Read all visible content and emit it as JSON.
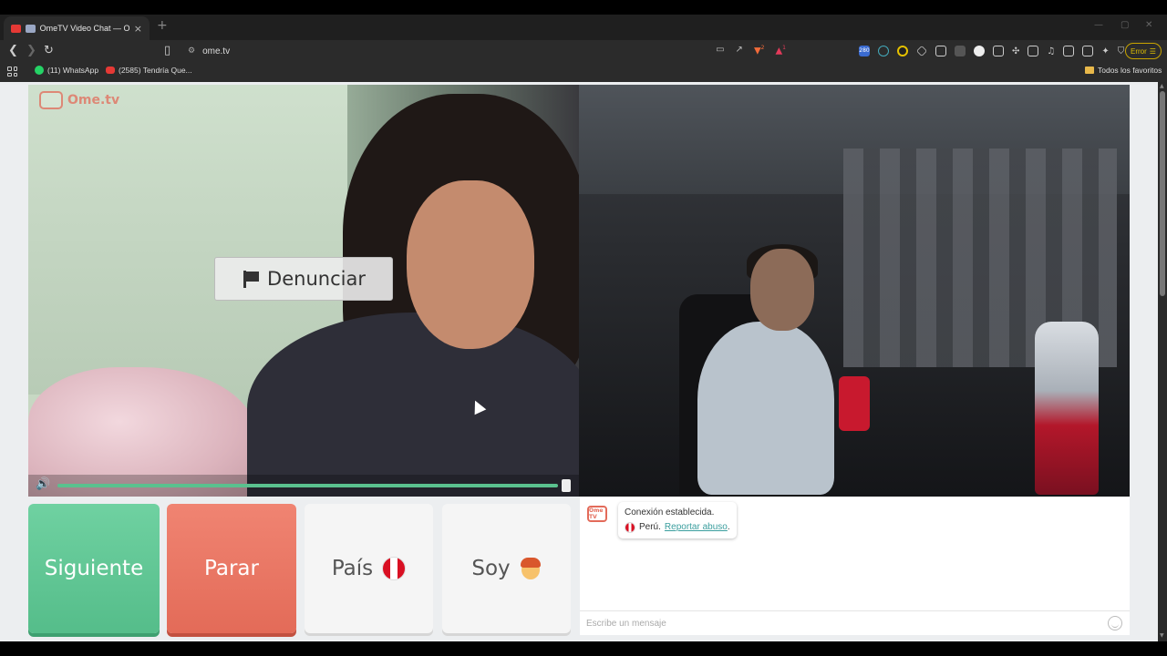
{
  "browser": {
    "tab_title": "OmeTV Video Chat — Omeg",
    "tab_close": "×",
    "new_tab": "+",
    "url": "ome.tv",
    "shield_count": "2",
    "alert_count": "1",
    "ext_badge": "280",
    "error_label": "Error",
    "bookmarks": [
      {
        "label": "(11) WhatsApp",
        "color": "#25d366"
      },
      {
        "label": "(2585) Tendría Que...",
        "color": "#e53935"
      }
    ],
    "all_bookmarks_label": "Todos los favoritos"
  },
  "site": {
    "logo_text": "Ome.tv",
    "report_label": "Denunciar",
    "volume_level": 0.98
  },
  "controls": {
    "next_label": "Siguiente",
    "stop_label": "Parar",
    "country_label": "País",
    "gender_label": "Soy"
  },
  "chat": {
    "avatar_text": "Ome TV",
    "connected_text": "Conexión establecida.",
    "country_text": "Perú.",
    "report_link": "Reportar abuso",
    "report_suffix": ".",
    "placeholder": "Escribe un mensaje"
  },
  "colors": {
    "next": "#5ac59a",
    "stop": "#e8705d",
    "accent": "#e36b5a",
    "link": "#3a9e9e"
  }
}
